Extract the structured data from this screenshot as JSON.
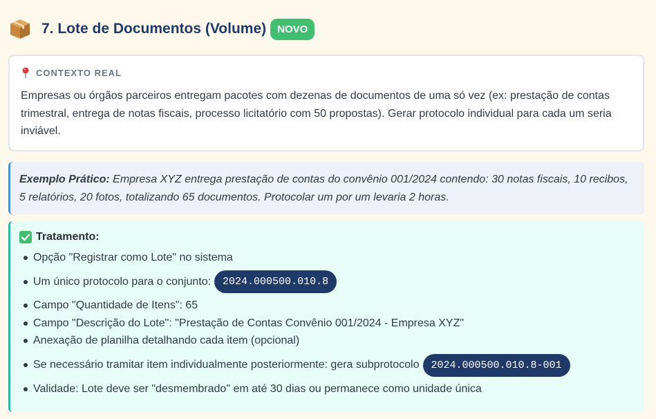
{
  "header": {
    "icon": "package-icon",
    "title": "7. Lote de Documentos (Volume)",
    "badge": "NOVO"
  },
  "context": {
    "icon": "pin-icon",
    "label": "CONTEXTO REAL",
    "text": "Empresas ou órgãos parceiros entregam pacotes com dezenas de documentos de uma só vez (ex: prestação de contas trimestral, entrega de notas fiscais, processo licitatório com 50 propostas). Gerar protocolo individual para cada um seria inviável."
  },
  "example": {
    "label": "Exemplo Prático:",
    "text": "Empresa XYZ entrega prestação de contas do convênio 001/2024 contendo: 30 notas fiscais, 10 recibos, 5 relatórios, 20 fotos, totalizando 65 documentos. Protocolar um por um levaria 2 horas."
  },
  "treatment": {
    "icon": "check-icon",
    "title": "Tratamento:",
    "items": [
      {
        "text": "Opção \"Registrar como Lote\" no sistema"
      },
      {
        "text": "Um único protocolo para o conjunto:",
        "code": "2024.000500.010.8"
      },
      {
        "text": "Campo \"Quantidade de Itens\": 65"
      },
      {
        "text": "Campo \"Descrição do Lote\": \"Prestação de Contas Convênio 001/2024 - Empresa XYZ\""
      },
      {
        "text": "Anexação de planilha detalhando cada item (opcional)"
      },
      {
        "text": "Se necessário tramitar item individualmente posteriormente: gera subprotocolo",
        "code": "2024.000500.010.8-001"
      },
      {
        "text": "Validade: Lote deve ser \"desmembrado\" em até 30 dias ou permanece como unidade única"
      }
    ]
  },
  "colors": {
    "title": "#1f3a68",
    "badge": "#3fbf6f",
    "code_bg": "#1f3a68",
    "example_border": "#4a90d9",
    "treatment_border": "#2bb5a6"
  }
}
